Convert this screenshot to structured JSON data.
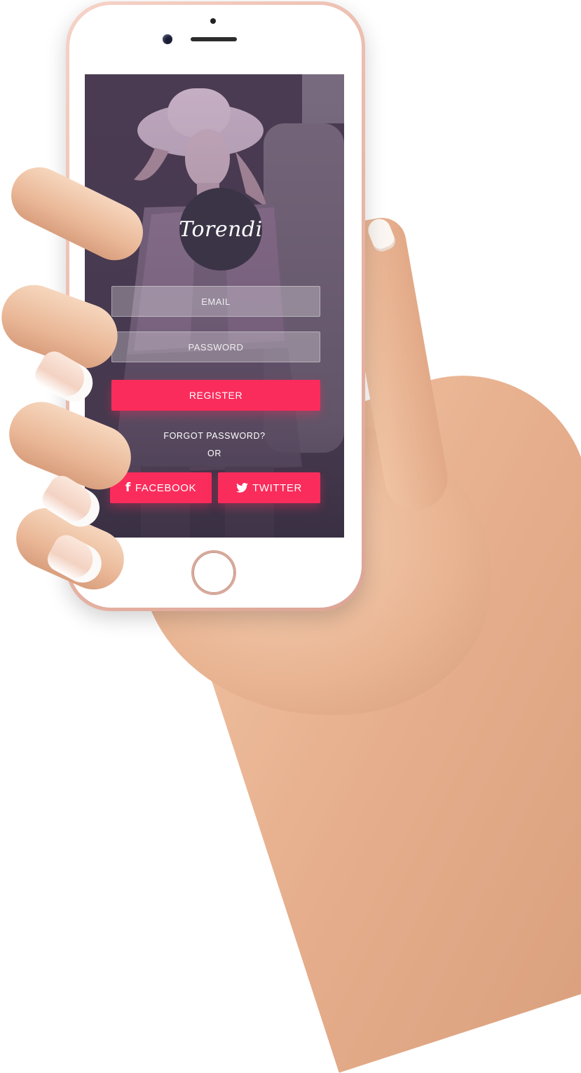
{
  "app": {
    "logo_text": "Torendi"
  },
  "form": {
    "email_placeholder": "EMAIL",
    "password_placeholder": "PASSWORD",
    "register_label": "REGISTER",
    "forgot_label": "FORGOT PASSWORD?",
    "or_label": "OR"
  },
  "social": {
    "facebook_label": "FACEBOOK",
    "twitter_label": "TWITTER",
    "facebook_icon": "facebook-icon",
    "twitter_icon": "twitter-icon"
  },
  "colors": {
    "accent": "#fa2c5b",
    "logo_bg": "#3b3447",
    "screen_tint": "#5b4a62"
  }
}
